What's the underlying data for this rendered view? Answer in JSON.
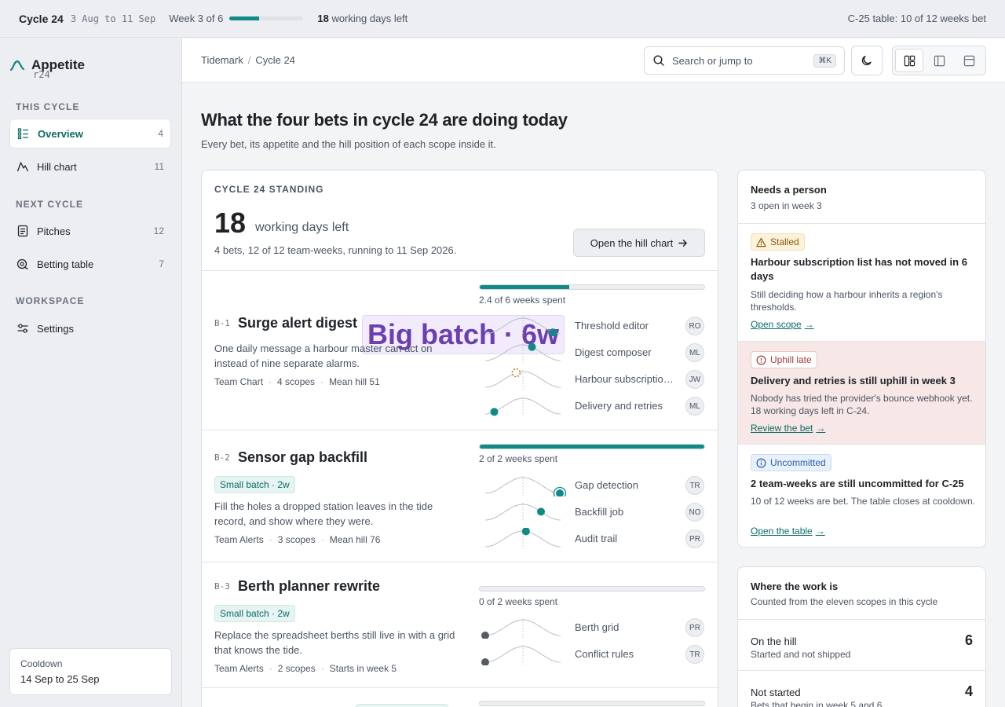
{
  "topbar": {
    "cycle": "Cycle 24",
    "dates": "3 Aug to 11 Sep",
    "week": "Week 3 of 6",
    "week_progress": 0.4,
    "days_num": "18",
    "days_label": "working days left",
    "table_status": "C-25 table: 10 of 12 weeks bet"
  },
  "sidebar": {
    "brand": "Appetite",
    "brand_tag": "r24",
    "sections": [
      "THIS CYCLE",
      "NEXT CYCLE",
      "WORKSPACE"
    ],
    "items": [
      {
        "label": "Overview",
        "count": "4",
        "icon": "overview-icon"
      },
      {
        "label": "Hill chart",
        "count": "11",
        "icon": "hill-icon"
      },
      {
        "label": "Pitches",
        "count": "12",
        "icon": "document-icon"
      },
      {
        "label": "Betting table",
        "count": "7",
        "icon": "chip-icon"
      },
      {
        "label": "Settings",
        "count": "",
        "icon": "sliders-icon"
      }
    ],
    "cooldown": {
      "label": "Cooldown",
      "dates": "14 Sep to 25 Sep"
    }
  },
  "header": {
    "breadcrumb": [
      "Tidemark",
      "Cycle 24"
    ],
    "search_placeholder": "Search or jump to",
    "search_shortcut": "⌘K"
  },
  "page": {
    "title": "What the four bets in cycle 24 are doing today",
    "subtitle": "Every bet, its appetite and the hill position of each scope inside it."
  },
  "standing": {
    "label": "CYCLE 24 STANDING",
    "days": "18",
    "days_label": "working days left",
    "summary": "4 bets, 12 of 12 team-weeks, running to 11 Sep 2026.",
    "button": "Open the hill chart",
    "bets": [
      {
        "code": "B-1",
        "name": "Surge alert digest",
        "badge": "Big batch · 6w",
        "desc": "One daily message a harbour master can act on instead of nine separate alarms.",
        "team": "Team Chart",
        "scopes": "4 scopes",
        "extra": "Mean hill 51",
        "progress": 0.4,
        "progress_text": "2.4 of 6 weeks spent",
        "scope_list": [
          {
            "name": "Threshold editor",
            "owner": "RO",
            "hill": 0.9
          },
          {
            "name": "Digest composer",
            "owner": "ML",
            "hill": 0.62
          },
          {
            "name": "Harbour subscription list",
            "owner": "JW",
            "hill": 0.41
          },
          {
            "name": "Delivery and retries",
            "owner": "ML",
            "hill": 0.12
          }
        ]
      },
      {
        "code": "B-2",
        "name": "Sensor gap backfill",
        "badge": "Small batch · 2w",
        "desc": "Fill the holes a dropped station leaves in the tide record, and show where they were.",
        "team": "Team Alerts",
        "scopes": "3 scopes",
        "extra": "Mean hill 76",
        "progress": 1.0,
        "progress_text": "2 of 2 weeks spent",
        "scope_list": [
          {
            "name": "Gap detection",
            "owner": "TR",
            "hill": 1.0
          },
          {
            "name": "Backfill job",
            "owner": "NO",
            "hill": 0.74
          },
          {
            "name": "Audit trail",
            "owner": "PR",
            "hill": 0.54
          }
        ]
      },
      {
        "code": "B-3",
        "name": "Berth planner rewrite",
        "badge": "Small batch · 2w",
        "desc": "Replace the spreadsheet berths still live in with a grid that knows the tide.",
        "team": "Team Alerts",
        "scopes": "2 scopes",
        "extra": "Starts in week 5",
        "progress": 0.0,
        "progress_text": "0 of 2 weeks spent",
        "scope_list": [
          {
            "name": "Berth grid",
            "owner": "PR",
            "hill": 0.0
          },
          {
            "name": "Conflict rules",
            "owner": "TR",
            "hill": 0.0
          }
        ]
      }
    ]
  },
  "needs": {
    "title": "Needs a person",
    "subtitle": "3 open in week 3",
    "alerts": [
      {
        "tag": "Stalled",
        "title": "Harbour subscription list has not moved in 6 days",
        "body": "Still deciding how a harbour inherits a region's thresholds.",
        "link": "Open scope"
      },
      {
        "tag": "Uphill late",
        "title": "Delivery and retries is still uphill in week 3",
        "body": "Nobody has tried the provider's bounce webhook yet. 18 working days left in C-24.",
        "link": "Review the bet"
      },
      {
        "tag": "Uncommitted",
        "title": "2 team-weeks are still uncommitted for C-25",
        "body": "10 of 12 weeks are bet. The table closes at cooldown.",
        "link": "Open the table"
      }
    ]
  },
  "work": {
    "title": "Where the work is",
    "subtitle": "Counted from the eleven scopes in this cycle",
    "rows": [
      {
        "title": "On the hill",
        "sub": "Started and not shipped",
        "count": "6"
      },
      {
        "title": "Not started",
        "sub": "Bets that begin in week 5 and 6",
        "count": "4"
      }
    ]
  },
  "colors": {
    "accent": "#0f8a86",
    "stalled": "#8a5a08",
    "late": "#a63a3a",
    "uncommitted": "#2f5fa8"
  }
}
